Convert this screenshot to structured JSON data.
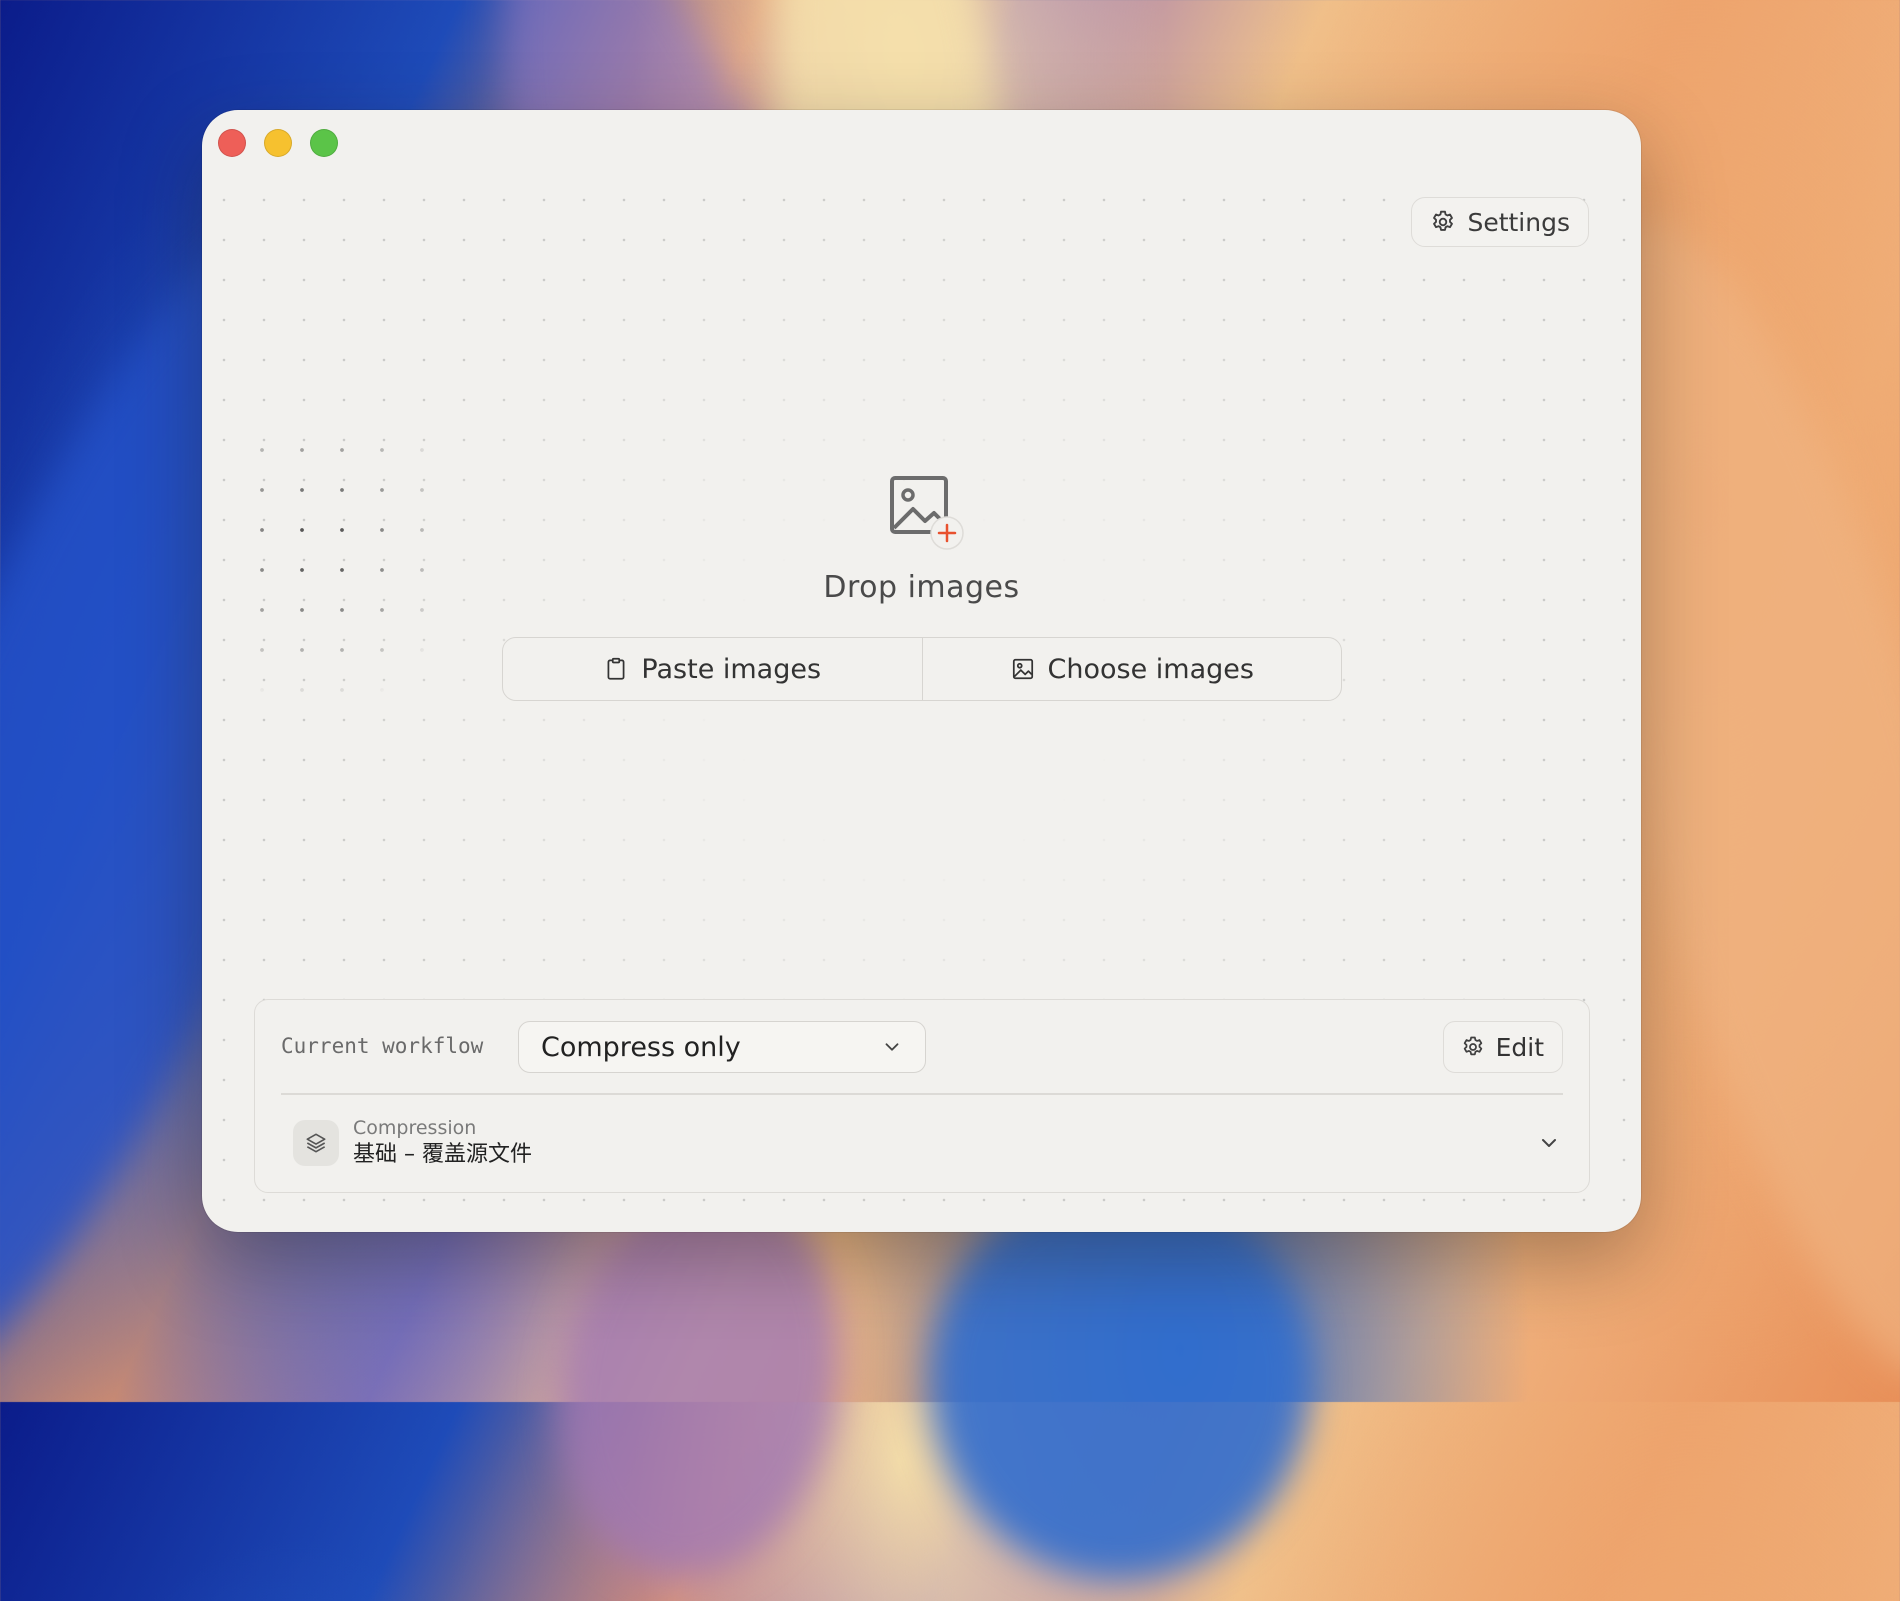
{
  "window": {
    "controls": [
      "close",
      "minimize",
      "maximize"
    ]
  },
  "toolbar": {
    "settings_label": "Settings",
    "settings_icon": "gear-icon"
  },
  "dropzone": {
    "icon": "image-add-icon",
    "label": "Drop images",
    "buttons": [
      {
        "label": "Paste images",
        "icon": "clipboard-icon"
      },
      {
        "label": "Choose images",
        "icon": "image-icon"
      }
    ]
  },
  "workflow": {
    "label": "Current workflow",
    "selected": "Compress only",
    "edit_label": "Edit",
    "step": {
      "title": "Compression",
      "subtitle": "基础 – 覆盖源文件",
      "icon": "layers-icon"
    }
  },
  "colors": {
    "window_bg": "#f2f1ee",
    "accent_plus": "#e8512e",
    "close": "#ee5f58",
    "minimize": "#f6c12f",
    "maximize": "#5bc448"
  }
}
